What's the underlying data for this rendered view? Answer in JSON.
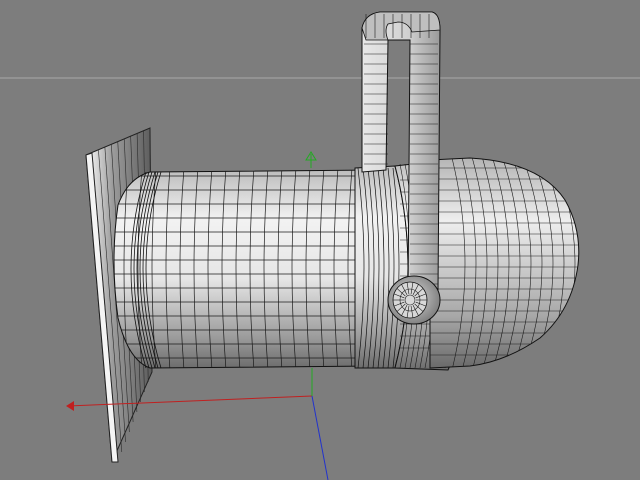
{
  "viewport": {
    "background": "#7d7d7d",
    "horizon_color": "#a9a9a9"
  },
  "model": {
    "surface_color": "#cfcfcf",
    "wire_color": "#1a1a1a",
    "components": [
      "bracket",
      "barrel",
      "front-flange",
      "back-dome",
      "knob"
    ]
  },
  "axes": {
    "x_color": "#c02020",
    "y_color": "#22aa22",
    "z_color": "#2233cc"
  }
}
